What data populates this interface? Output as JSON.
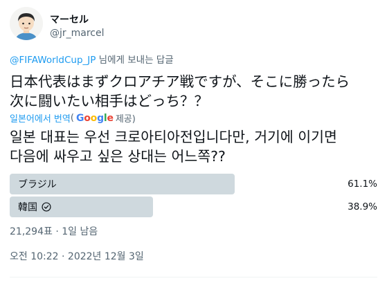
{
  "author": {
    "display_name": "マーセル",
    "handle": "@jr_marcel"
  },
  "reply": {
    "mention": "@FIFAWorldCup_JP",
    "suffix": " 님에게 보내는 답글"
  },
  "tweet": {
    "original_line1": "日本代表はまずクロアチア戦ですが、そこに勝ったら",
    "original_line2": "次に闘いたい相手はどっち？？",
    "translate_link": "일본어에서 번역",
    "translate_open": "(",
    "google": [
      "G",
      "o",
      "o",
      "g",
      "l",
      "e"
    ],
    "translate_provided": " 제공)",
    "translated_line1": "일본 대표는 우선 크로아티아전입니다만, 거기에 이기면",
    "translated_line2": "다음에 싸우고 싶은 상대는 어느쪽??"
  },
  "poll": {
    "options": [
      {
        "label": "ブラジル",
        "percent_text": "61.1%",
        "percent": 61.1,
        "winner": false
      },
      {
        "label": "韓国",
        "percent_text": "38.9%",
        "percent": 38.9,
        "winner": true
      }
    ],
    "meta": "21,294표 · 1일 남음"
  },
  "timestamp": "오전 10:22 · 2022년 12월 3일",
  "colors": {
    "link": "#1d9bf0",
    "secondary_text": "#536471",
    "poll_bar": "#cfd9de"
  }
}
